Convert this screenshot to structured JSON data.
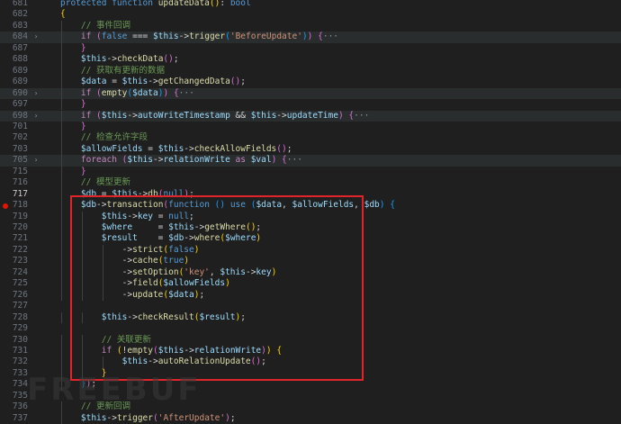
{
  "editor": {
    "breakpoint_line": "718",
    "active_line": "717",
    "watermark": "FREEBUF",
    "lines": [
      {
        "n": "681",
        "fold": "",
        "bg": false,
        "tokens": [
          [
            "t-kw",
            "protected "
          ],
          [
            "t-kw",
            "function "
          ],
          [
            "t-fn",
            "updateData"
          ],
          [
            "t-b1",
            "("
          ],
          [
            "t-b1",
            ")"
          ],
          [
            "t-p",
            ": "
          ],
          [
            "t-kw",
            "bool"
          ]
        ]
      },
      {
        "n": "682",
        "fold": "",
        "bg": false,
        "tokens": [
          [
            "t-b1",
            "{"
          ]
        ]
      },
      {
        "n": "683",
        "fold": "",
        "bg": false,
        "tokens": [
          [
            "t-cm",
            "    // 事件回调"
          ]
        ]
      },
      {
        "n": "684",
        "fold": "›",
        "bg": true,
        "tokens": [
          [
            "t-ctrl",
            "    if "
          ],
          [
            "t-b2",
            "("
          ],
          [
            "t-kw",
            "false "
          ],
          [
            "t-op",
            "=== "
          ],
          [
            "t-var",
            "$this"
          ],
          [
            "t-op",
            "->"
          ],
          [
            "t-fn",
            "trigger"
          ],
          [
            "t-b3",
            "("
          ],
          [
            "t-str",
            "'BeforeUpdate'"
          ],
          [
            "t-b3",
            ")"
          ],
          [
            "t-b2",
            ")"
          ],
          [
            "t-p",
            " "
          ],
          [
            "t-b2",
            "{"
          ],
          [
            "t-fold",
            "···"
          ]
        ]
      },
      {
        "n": "687",
        "fold": "",
        "bg": false,
        "tokens": [
          [
            "t-b2",
            "    }"
          ]
        ]
      },
      {
        "n": "688",
        "fold": "",
        "bg": false,
        "tokens": [
          [
            "t-var",
            "    $this"
          ],
          [
            "t-op",
            "->"
          ],
          [
            "t-fn",
            "checkData"
          ],
          [
            "t-b2",
            "("
          ],
          [
            "t-b2",
            ")"
          ],
          [
            "t-p",
            ";"
          ]
        ]
      },
      {
        "n": "689",
        "fold": "",
        "bg": false,
        "tokens": [
          [
            "t-cm",
            "    // 获取有更新的数据"
          ]
        ]
      },
      {
        "n": "689",
        "fold": "",
        "bg": false,
        "tokens": [
          [
            "t-var",
            "    $data "
          ],
          [
            "t-op",
            "= "
          ],
          [
            "t-var",
            "$this"
          ],
          [
            "t-op",
            "->"
          ],
          [
            "t-fn",
            "getChangedData"
          ],
          [
            "t-b2",
            "("
          ],
          [
            "t-b2",
            ")"
          ],
          [
            "t-p",
            ";"
          ]
        ]
      },
      {
        "n": "690",
        "fold": "›",
        "bg": true,
        "tokens": [
          [
            "t-ctrl",
            "    if "
          ],
          [
            "t-b2",
            "("
          ],
          [
            "t-fn",
            "empty"
          ],
          [
            "t-b3",
            "("
          ],
          [
            "t-var",
            "$data"
          ],
          [
            "t-b3",
            ")"
          ],
          [
            "t-b2",
            ")"
          ],
          [
            "t-p",
            " "
          ],
          [
            "t-b2",
            "{"
          ],
          [
            "t-fold",
            "···"
          ]
        ]
      },
      {
        "n": "697",
        "fold": "",
        "bg": false,
        "tokens": [
          [
            "t-b2",
            "    }"
          ]
        ]
      },
      {
        "n": "698",
        "fold": "›",
        "bg": true,
        "tokens": [
          [
            "t-ctrl",
            "    if "
          ],
          [
            "t-b2",
            "("
          ],
          [
            "t-var",
            "$this"
          ],
          [
            "t-op",
            "->"
          ],
          [
            "t-var",
            "autoWriteTimestamp "
          ],
          [
            "t-op",
            "&& "
          ],
          [
            "t-var",
            "$this"
          ],
          [
            "t-op",
            "->"
          ],
          [
            "t-var",
            "updateTime"
          ],
          [
            "t-b2",
            ")"
          ],
          [
            "t-p",
            " "
          ],
          [
            "t-b2",
            "{"
          ],
          [
            "t-fold",
            "···"
          ]
        ]
      },
      {
        "n": "701",
        "fold": "",
        "bg": false,
        "tokens": [
          [
            "t-b2",
            "    }"
          ]
        ]
      },
      {
        "n": "702",
        "fold": "",
        "bg": false,
        "tokens": [
          [
            "t-cm",
            "    // 检查允许字段"
          ]
        ]
      },
      {
        "n": "703",
        "fold": "",
        "bg": false,
        "tokens": [
          [
            "t-var",
            "    $allowFields "
          ],
          [
            "t-op",
            "= "
          ],
          [
            "t-var",
            "$this"
          ],
          [
            "t-op",
            "->"
          ],
          [
            "t-fn",
            "checkAllowFields"
          ],
          [
            "t-b2",
            "("
          ],
          [
            "t-b2",
            ")"
          ],
          [
            "t-p",
            ";"
          ]
        ]
      },
      {
        "n": "705",
        "fold": "›",
        "bg": true,
        "tokens": [
          [
            "t-ctrl",
            "    foreach "
          ],
          [
            "t-b2",
            "("
          ],
          [
            "t-var",
            "$this"
          ],
          [
            "t-op",
            "->"
          ],
          [
            "t-var",
            "relationWrite "
          ],
          [
            "t-ctrl",
            "as "
          ],
          [
            "t-var",
            "$val"
          ],
          [
            "t-b2",
            ")"
          ],
          [
            "t-p",
            " "
          ],
          [
            "t-b2",
            "{"
          ],
          [
            "t-fold",
            "···"
          ]
        ]
      },
      {
        "n": "715",
        "fold": "",
        "bg": false,
        "tokens": [
          [
            "t-b2",
            "    }"
          ]
        ]
      },
      {
        "n": "716",
        "fold": "",
        "bg": false,
        "tokens": [
          [
            "t-cm",
            "    // 模型更新"
          ]
        ]
      },
      {
        "n": "717",
        "fold": "",
        "bg": false,
        "tokens": [
          [
            "t-var",
            "    $db "
          ],
          [
            "t-op",
            "= "
          ],
          [
            "t-var",
            "$this"
          ],
          [
            "t-op",
            "->"
          ],
          [
            "t-fn",
            "db"
          ],
          [
            "t-b2",
            "("
          ],
          [
            "t-kw",
            "null"
          ],
          [
            "t-b2",
            ")"
          ],
          [
            "t-p",
            ";"
          ]
        ]
      },
      {
        "n": "718",
        "fold": "",
        "bg": false,
        "tokens": [
          [
            "t-var",
            "    $db"
          ],
          [
            "t-op",
            "->"
          ],
          [
            "t-fn",
            "transaction"
          ],
          [
            "t-b2",
            "("
          ],
          [
            "t-kw",
            "function "
          ],
          [
            "t-b3",
            "("
          ],
          [
            "t-b3",
            ")"
          ],
          [
            "t-kw",
            " use "
          ],
          [
            "t-b3",
            "("
          ],
          [
            "t-var",
            "$data"
          ],
          [
            "t-p",
            ", "
          ],
          [
            "t-var",
            "$allowFields"
          ],
          [
            "t-p",
            ", "
          ],
          [
            "t-var",
            "$db"
          ],
          [
            "t-b3",
            ")"
          ],
          [
            "t-p",
            " "
          ],
          [
            "t-b3",
            "{"
          ]
        ]
      },
      {
        "n": "719",
        "fold": "",
        "bg": false,
        "tokens": [
          [
            "t-var",
            "        $this"
          ],
          [
            "t-op",
            "->"
          ],
          [
            "t-var",
            "key "
          ],
          [
            "t-op",
            "= "
          ],
          [
            "t-kw",
            "null"
          ],
          [
            "t-p",
            ";"
          ]
        ]
      },
      {
        "n": "720",
        "fold": "",
        "bg": false,
        "tokens": [
          [
            "t-var",
            "        $where     "
          ],
          [
            "t-op",
            "= "
          ],
          [
            "t-var",
            "$this"
          ],
          [
            "t-op",
            "->"
          ],
          [
            "t-fn",
            "getWhere"
          ],
          [
            "t-b1",
            "("
          ],
          [
            "t-b1",
            ")"
          ],
          [
            "t-p",
            ";"
          ]
        ]
      },
      {
        "n": "721",
        "fold": "",
        "bg": false,
        "tokens": [
          [
            "t-var",
            "        $result    "
          ],
          [
            "t-op",
            "= "
          ],
          [
            "t-var",
            "$db"
          ],
          [
            "t-op",
            "->"
          ],
          [
            "t-fn",
            "where"
          ],
          [
            "t-b1",
            "("
          ],
          [
            "t-var",
            "$where"
          ],
          [
            "t-b1",
            ")"
          ]
        ]
      },
      {
        "n": "722",
        "fold": "",
        "bg": false,
        "tokens": [
          [
            "t-op",
            "            ->"
          ],
          [
            "t-fn",
            "strict"
          ],
          [
            "t-b1",
            "("
          ],
          [
            "t-kw",
            "false"
          ],
          [
            "t-b1",
            ")"
          ]
        ]
      },
      {
        "n": "723",
        "fold": "",
        "bg": false,
        "tokens": [
          [
            "t-op",
            "            ->"
          ],
          [
            "t-fn",
            "cache"
          ],
          [
            "t-b1",
            "("
          ],
          [
            "t-kw",
            "true"
          ],
          [
            "t-b1",
            ")"
          ]
        ]
      },
      {
        "n": "724",
        "fold": "",
        "bg": false,
        "tokens": [
          [
            "t-op",
            "            ->"
          ],
          [
            "t-fn",
            "setOption"
          ],
          [
            "t-b1",
            "("
          ],
          [
            "t-str",
            "'key'"
          ],
          [
            "t-p",
            ", "
          ],
          [
            "t-var",
            "$this"
          ],
          [
            "t-op",
            "->"
          ],
          [
            "t-var",
            "key"
          ],
          [
            "t-b1",
            ")"
          ]
        ]
      },
      {
        "n": "725",
        "fold": "",
        "bg": false,
        "tokens": [
          [
            "t-op",
            "            ->"
          ],
          [
            "t-fn",
            "field"
          ],
          [
            "t-b1",
            "("
          ],
          [
            "t-var",
            "$allowFields"
          ],
          [
            "t-b1",
            ")"
          ]
        ]
      },
      {
        "n": "726",
        "fold": "",
        "bg": false,
        "tokens": [
          [
            "t-op",
            "            ->"
          ],
          [
            "t-fn",
            "update"
          ],
          [
            "t-b1",
            "("
          ],
          [
            "t-var",
            "$data"
          ],
          [
            "t-b1",
            ")"
          ],
          [
            "t-p",
            ";"
          ]
        ]
      },
      {
        "n": "727",
        "fold": "",
        "bg": false,
        "tokens": []
      },
      {
        "n": "728",
        "fold": "",
        "bg": false,
        "tokens": [
          [
            "t-var",
            "        $this"
          ],
          [
            "t-op",
            "->"
          ],
          [
            "t-fn",
            "checkResult"
          ],
          [
            "t-b1",
            "("
          ],
          [
            "t-var",
            "$result"
          ],
          [
            "t-b1",
            ")"
          ],
          [
            "t-p",
            ";"
          ]
        ]
      },
      {
        "n": "729",
        "fold": "",
        "bg": false,
        "tokens": []
      },
      {
        "n": "730",
        "fold": "",
        "bg": false,
        "tokens": [
          [
            "t-cm",
            "        // 关联更新"
          ]
        ]
      },
      {
        "n": "731",
        "fold": "",
        "bg": false,
        "tokens": [
          [
            "t-ctrl",
            "        if "
          ],
          [
            "t-b1",
            "("
          ],
          [
            "t-op",
            "!"
          ],
          [
            "t-fn",
            "empty"
          ],
          [
            "t-b2",
            "("
          ],
          [
            "t-var",
            "$this"
          ],
          [
            "t-op",
            "->"
          ],
          [
            "t-var",
            "relationWrite"
          ],
          [
            "t-b2",
            ")"
          ],
          [
            "t-b1",
            ")"
          ],
          [
            "t-p",
            " "
          ],
          [
            "t-b1",
            "{"
          ]
        ]
      },
      {
        "n": "732",
        "fold": "",
        "bg": false,
        "tokens": [
          [
            "t-var",
            "            $this"
          ],
          [
            "t-op",
            "->"
          ],
          [
            "t-fn",
            "autoRelationUpdate"
          ],
          [
            "t-b2",
            "("
          ],
          [
            "t-b2",
            ")"
          ],
          [
            "t-p",
            ";"
          ]
        ]
      },
      {
        "n": "733",
        "fold": "",
        "bg": false,
        "tokens": [
          [
            "t-b1",
            "        }"
          ]
        ]
      },
      {
        "n": "734",
        "fold": "",
        "bg": false,
        "tokens": [
          [
            "t-b3",
            "    }"
          ],
          [
            "t-b2",
            ")"
          ],
          [
            "t-p",
            ";"
          ]
        ]
      },
      {
        "n": "735",
        "fold": "",
        "bg": false,
        "tokens": []
      },
      {
        "n": "736",
        "fold": "",
        "bg": false,
        "tokens": [
          [
            "t-cm",
            "    // 更新回调"
          ]
        ]
      },
      {
        "n": "737",
        "fold": "",
        "bg": false,
        "tokens": [
          [
            "t-var",
            "    $this"
          ],
          [
            "t-op",
            "->"
          ],
          [
            "t-fn",
            "trigger"
          ],
          [
            "t-b2",
            "("
          ],
          [
            "t-str",
            "'AfterUpdate'"
          ],
          [
            "t-b2",
            ")"
          ],
          [
            "t-p",
            ";"
          ]
        ]
      }
    ]
  }
}
